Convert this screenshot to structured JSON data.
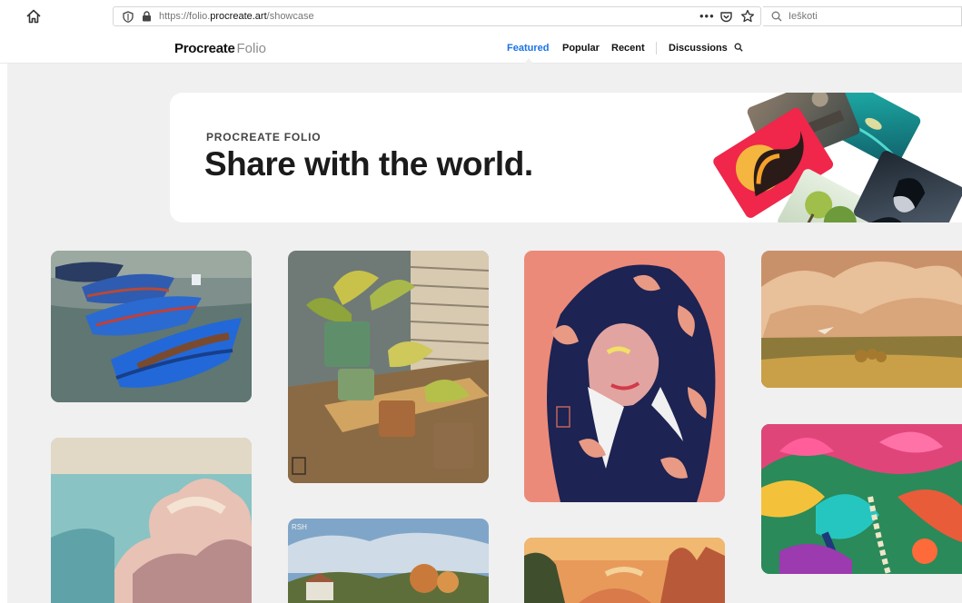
{
  "browser": {
    "url_prefix": "https://folio.",
    "url_domain": "procreate.art",
    "url_path": "/showcase",
    "url_menu": "•••",
    "search_placeholder": "Ieškoti"
  },
  "site": {
    "logo_primary": "Procreate",
    "logo_secondary": "Folio",
    "nav": [
      {
        "label": "Featured",
        "active": true
      },
      {
        "label": "Popular",
        "active": false
      },
      {
        "label": "Recent",
        "active": false
      },
      {
        "label": "Discussions",
        "active": false
      }
    ]
  },
  "hero": {
    "eyebrow": "PROCREATE FOLIO",
    "title": "Share with the world."
  },
  "gallery": {
    "items": [
      {
        "name": "artwork-blue-boats"
      },
      {
        "name": "artwork-window-plants"
      },
      {
        "name": "artwork-flower-hood-portrait"
      },
      {
        "name": "artwork-clouds-landscape"
      },
      {
        "name": "artwork-cloud-sky"
      },
      {
        "name": "artwork-jungle-parrot"
      },
      {
        "name": "artwork-village-trees"
      },
      {
        "name": "artwork-canyon-sunset"
      }
    ]
  },
  "colors": {
    "accent": "#1a72e6",
    "background": "#f0f0f0"
  }
}
